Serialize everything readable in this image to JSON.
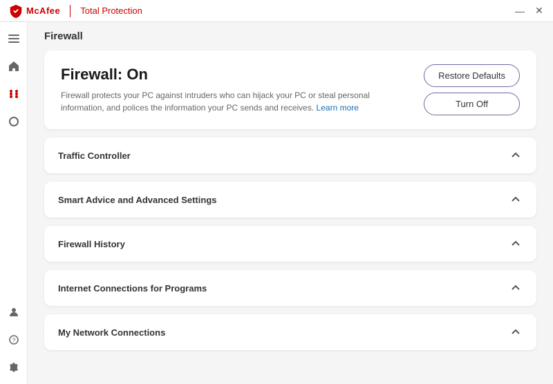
{
  "titlebar": {
    "logo_text": "McAfee",
    "app_name": "Total Protection",
    "minimize_label": "—",
    "close_label": "✕"
  },
  "sidebar": {
    "icons": [
      {
        "name": "hamburger-icon",
        "symbol": "☰",
        "active": false
      },
      {
        "name": "home-icon",
        "symbol": "⌂",
        "active": false
      },
      {
        "name": "grid-icon",
        "symbol": "⠿",
        "active": true
      },
      {
        "name": "circle-icon",
        "symbol": "○",
        "active": false
      }
    ],
    "bottom_icons": [
      {
        "name": "user-icon",
        "symbol": "👤",
        "active": false
      },
      {
        "name": "help-icon",
        "symbol": "?",
        "active": false
      },
      {
        "name": "settings-icon",
        "symbol": "⚙",
        "active": false
      }
    ]
  },
  "page": {
    "header": "Firewall",
    "status_card": {
      "title": "Firewall: On",
      "description": "Firewall protects your PC against intruders who can hijack your PC or steal personal information, and polices the information your PC sends and receives.",
      "learn_more_text": "Learn more",
      "restore_defaults_label": "Restore Defaults",
      "turn_off_label": "Turn Off"
    },
    "accordion_sections": [
      {
        "title": "Traffic Controller"
      },
      {
        "title": "Smart Advice and Advanced Settings"
      },
      {
        "title": "Firewall History"
      },
      {
        "title": "Internet Connections for Programs"
      },
      {
        "title": "My Network Connections"
      }
    ]
  }
}
